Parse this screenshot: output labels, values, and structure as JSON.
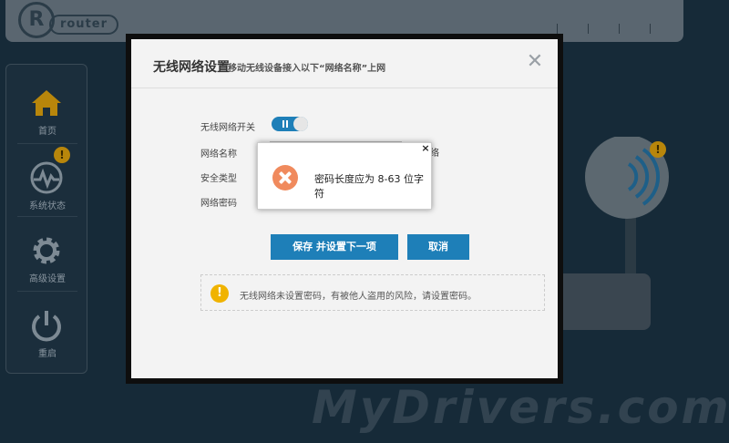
{
  "header": {
    "logo_mark": "R",
    "logo_text": "router",
    "links": [
      "",
      ""
    ]
  },
  "sidebar": {
    "items": [
      {
        "label": "首页",
        "icon": "home-icon"
      },
      {
        "label": "系统状态",
        "icon": "pulse-icon"
      },
      {
        "label": "高级设置",
        "icon": "gear-icon"
      },
      {
        "label": "重启",
        "icon": "power-icon"
      }
    ],
    "badge": "!"
  },
  "dialog": {
    "title": "无线网络设置",
    "subtitle": "移动无线设备接入以下“网络名称”上网",
    "close": "✕",
    "fields": {
      "wifi_switch_label": "无线网络开关",
      "ssid_label": "网络名称",
      "hide_label": "网络",
      "security_label": "安全类型",
      "password_label": "网络密码"
    },
    "save_button": "保存 并设置下一项",
    "cancel_button": "取消",
    "notice": "无线网络未设置密码，有被他人盗用的风险，请设置密码。",
    "notice_icon": "!"
  },
  "popup": {
    "close": "×",
    "message": "密码长度应为 8-63 位字符"
  },
  "footer": {
    "watermark": "MyDrivers.com"
  },
  "colors": {
    "accent": "#1e7fb8",
    "error": "#f08a5d",
    "warning": "#f0b300"
  }
}
